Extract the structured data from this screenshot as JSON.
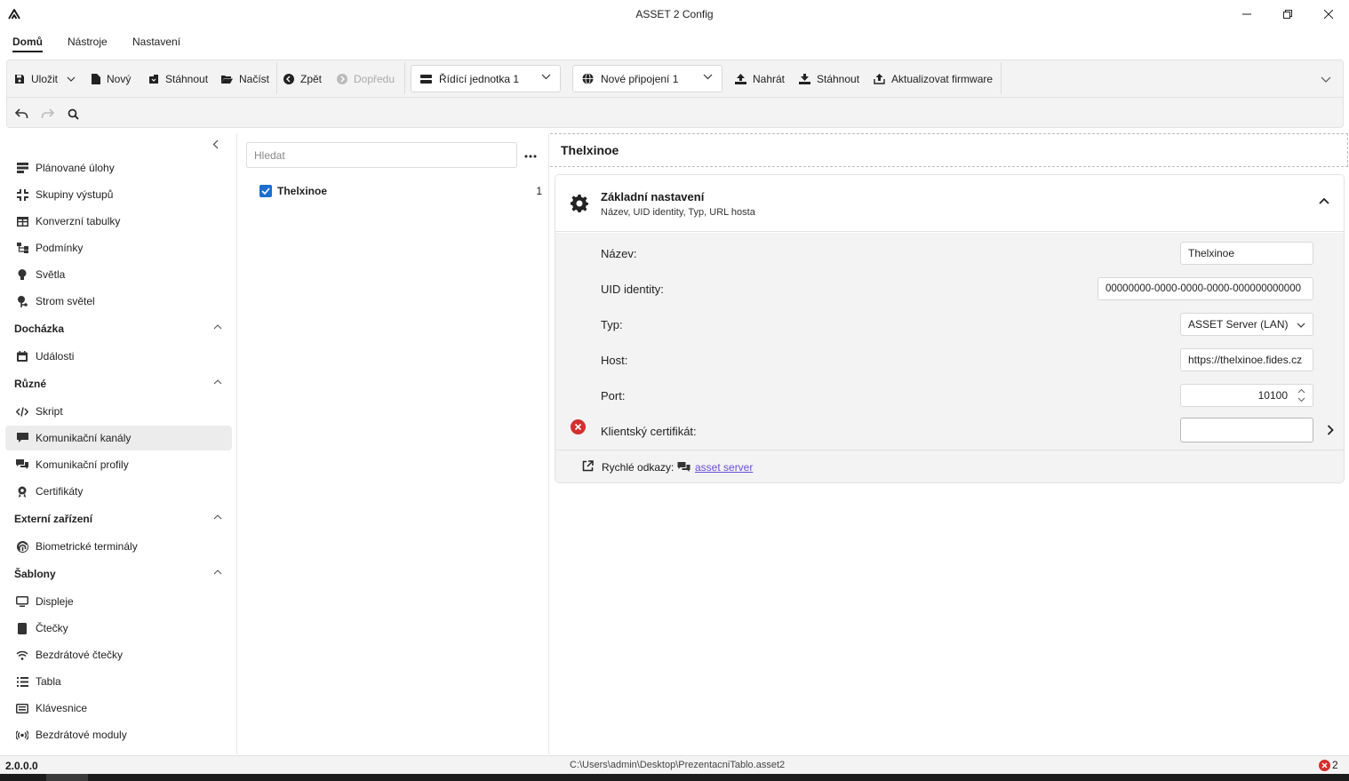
{
  "window": {
    "title": "ASSET 2 Config"
  },
  "menu": {
    "tabs": [
      "Domů",
      "Nástroje",
      "Nastavení"
    ]
  },
  "ribbon": {
    "save": "Uložit",
    "new": "Nový",
    "download": "Stáhnout",
    "load": "Načíst",
    "back": "Zpět",
    "forward": "Dopředu",
    "control_unit": "Řídící jednotka 1",
    "connection": "Nové připojení 1",
    "upload": "Nahrát",
    "download2": "Stáhnout",
    "update_firmware": "Aktualizovat firmware"
  },
  "sidebar": {
    "items": [
      {
        "label": "Plánované úlohy",
        "icon": "calendar-list-icon"
      },
      {
        "label": "Skupiny výstupů",
        "icon": "group-icon"
      },
      {
        "label": "Konverzní tabulky",
        "icon": "table-icon"
      },
      {
        "label": "Podmínky",
        "icon": "condition-icon"
      },
      {
        "label": "Světla",
        "icon": "lightbulb-icon"
      },
      {
        "label": "Strom světel",
        "icon": "tree-icon"
      }
    ],
    "sections": [
      {
        "title": "Docházka",
        "items": [
          {
            "label": "Události",
            "icon": "calendar-icon"
          }
        ]
      },
      {
        "title": "Různé",
        "items": [
          {
            "label": "Skript",
            "icon": "code-icon"
          },
          {
            "label": "Komunikační kanály",
            "icon": "chat-icon"
          },
          {
            "label": "Komunikační profily",
            "icon": "chats-icon"
          },
          {
            "label": "Certifikáty",
            "icon": "certificate-icon"
          }
        ]
      },
      {
        "title": "Externí zařízení",
        "items": [
          {
            "label": "Biometrické terminály",
            "icon": "fingerprint-icon"
          }
        ]
      },
      {
        "title": "Šablony",
        "items": [
          {
            "label": "Displeje",
            "icon": "monitor-icon"
          },
          {
            "label": "Čtečky",
            "icon": "reader-icon"
          },
          {
            "label": "Bezdrátové čtečky",
            "icon": "wifi-icon"
          },
          {
            "label": "Tabla",
            "icon": "list-icon"
          },
          {
            "label": "Klávesnice",
            "icon": "keyboard-icon"
          },
          {
            "label": "Bezdrátové moduly",
            "icon": "radio-icon"
          }
        ]
      }
    ]
  },
  "list": {
    "search_placeholder": "Hledat",
    "items": [
      {
        "label": "Thelxinoe",
        "count": "1",
        "checked": true
      }
    ]
  },
  "detail": {
    "title": "Thelxinoe",
    "card": {
      "title": "Základní nastavení",
      "subtitle": "Název, UID identity, Typ, URL hosta",
      "fields": {
        "name_label": "Název:",
        "name_value": "Thelxinoe",
        "uid_label": "UID identity:",
        "uid_value": "00000000-0000-0000-0000-000000000000",
        "type_label": "Typ:",
        "type_value": "ASSET Server (LAN)",
        "host_label": "Host:",
        "host_value": "https://thelxinoe.fides.cz",
        "port_label": "Port:",
        "port_value": "10100",
        "cert_label": "Klientský certifikát:",
        "cert_value": ""
      },
      "quick_links_label": "Rychlé odkazy:",
      "quick_link": "asset server"
    }
  },
  "status": {
    "version": "2.0.0.0",
    "path": "C:\\Users\\admin\\Desktop\\PrezentacniTablo.asset2",
    "error_count": "2"
  },
  "colors": {
    "accent": "#1a6fd1",
    "error": "#d32f2f",
    "link": "#6a4fd8"
  }
}
